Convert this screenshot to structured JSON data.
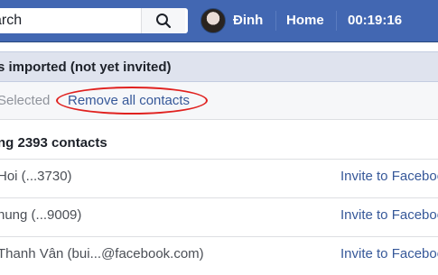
{
  "header": {
    "search_placeholder": "Search",
    "search_value": "arch",
    "user_name": "Đinh",
    "home_label": "Home",
    "clock": "00:19:16"
  },
  "imported_bar": {
    "text": "s imported (not yet invited)"
  },
  "selection": {
    "selected_label": "Selected",
    "remove_all_label": "Remove all contacts"
  },
  "contacts_heading": "ng 2393 contacts",
  "contacts": [
    {
      "name": "Hoi (...3730)",
      "action": "Invite to Facebook"
    },
    {
      "name": "hung (...9009)",
      "action": "Invite to Facebook"
    },
    {
      "name": "Thanh Vân (bui...@facebook.com)",
      "action": "Invite to Facebook"
    }
  ],
  "colors": {
    "brand": "#4267b2",
    "link": "#365899",
    "highlight_circle": "#e0211f"
  }
}
